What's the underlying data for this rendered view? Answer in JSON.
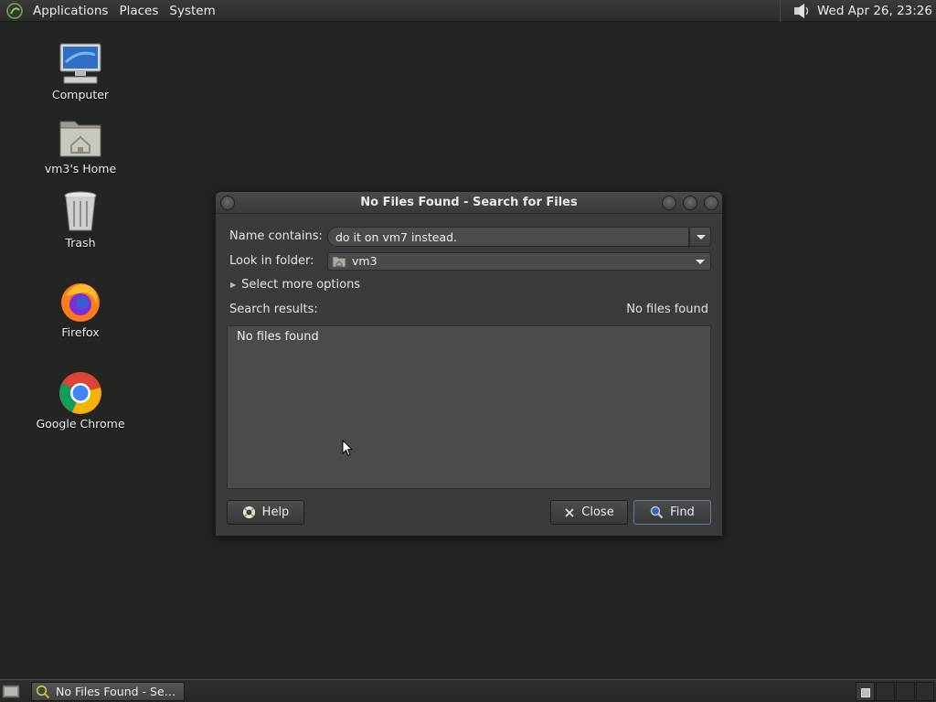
{
  "top_panel": {
    "menus": [
      "Applications",
      "Places",
      "System"
    ],
    "clock": "Wed Apr 26, 23:26"
  },
  "desktop": {
    "icons": [
      {
        "label": "Computer",
        "icon": "computer-icon"
      },
      {
        "label": "vm3's Home",
        "icon": "home-folder-icon"
      },
      {
        "label": "Trash",
        "icon": "trash-icon"
      },
      {
        "label": "Firefox",
        "icon": "firefox-icon"
      },
      {
        "label": "Google Chrome",
        "icon": "chrome-icon"
      }
    ]
  },
  "dialog": {
    "title": "No Files Found - Search for Files",
    "name_label": "Name contains:",
    "name_value": "do it on vm7 instead.",
    "folder_label": "Look in folder:",
    "folder_value": "vm3",
    "more_options": "Select more options",
    "results_label": "Search results:",
    "results_status": "No files found",
    "results_items": [
      "No files found"
    ],
    "buttons": {
      "help": "Help",
      "close": "Close",
      "find": "Find"
    }
  },
  "taskbar": {
    "task_label": "No Files Found - Se…"
  },
  "colors": {
    "desktop_bg": "#232522",
    "dialog_bg": "#3b3b3a",
    "find_accent": "#5c7da8"
  }
}
